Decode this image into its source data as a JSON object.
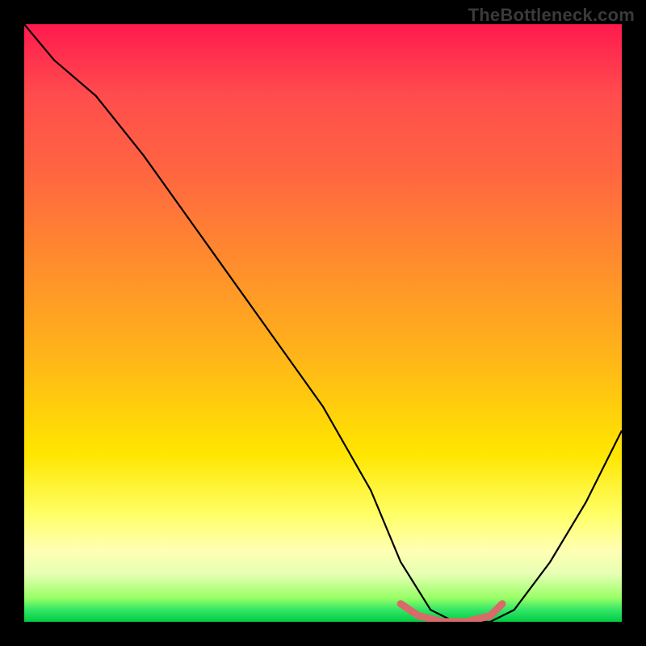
{
  "watermark": "TheBottleneck.com",
  "chart_data": {
    "type": "line",
    "title": "",
    "xlabel": "",
    "ylabel": "",
    "xlim": [
      0,
      100
    ],
    "ylim": [
      0,
      100
    ],
    "background_gradient": {
      "orientation": "vertical",
      "stops": [
        {
          "pos": 0,
          "color": "#ff1a4d"
        },
        {
          "pos": 55,
          "color": "#ffb31a"
        },
        {
          "pos": 82,
          "color": "#ffff66"
        },
        {
          "pos": 100,
          "color": "#00cc44"
        }
      ]
    },
    "series": [
      {
        "name": "bottleneck-curve",
        "color": "#000000",
        "x": [
          0,
          5,
          12,
          20,
          30,
          40,
          50,
          58,
          63,
          68,
          72,
          75,
          78,
          82,
          88,
          94,
          100
        ],
        "y": [
          100,
          94,
          88,
          78,
          64,
          50,
          36,
          22,
          10,
          2,
          0,
          0,
          0,
          2,
          10,
          20,
          32
        ]
      },
      {
        "name": "optimal-highlight",
        "color": "#d86a6a",
        "x": [
          63,
          66,
          70,
          74,
          78,
          80
        ],
        "y": [
          3,
          1,
          0,
          0,
          1,
          3
        ]
      }
    ],
    "optimal_range_pct": [
      63,
      80
    ]
  }
}
